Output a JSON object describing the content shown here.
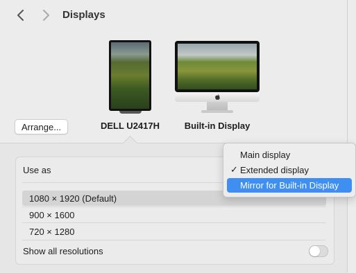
{
  "header": {
    "title": "Displays"
  },
  "displays": {
    "arrange_label": "Arrange...",
    "external_name": "DELL U2417H",
    "builtin_name": "Built-in Display"
  },
  "settings": {
    "use_as_label": "Use as",
    "resolutions": [
      {
        "label": "1080 × 1920 (Default)",
        "selected": true
      },
      {
        "label": "900 × 1600",
        "selected": false
      },
      {
        "label": "720 × 1280",
        "selected": false
      }
    ],
    "show_all_label": "Show all resolutions",
    "show_all_on": false
  },
  "use_as_menu": {
    "items": [
      {
        "label": "Main display",
        "checked": false,
        "highlighted": false
      },
      {
        "label": "Extended display",
        "checked": true,
        "highlighted": false
      },
      {
        "label": "Mirror for Built-in Display",
        "checked": false,
        "highlighted": true
      }
    ]
  },
  "colors": {
    "accent": "#3f8ef2",
    "window_bg": "#ececec"
  },
  "icons": {
    "back": "chevron-left-icon",
    "forward": "chevron-right-icon",
    "check": "checkmark-icon",
    "apple": "apple-logo-icon"
  }
}
